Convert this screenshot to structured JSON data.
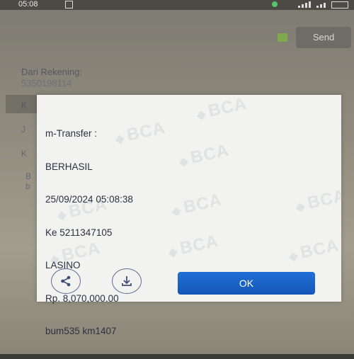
{
  "status_bar": {
    "time": "05:08"
  },
  "background": {
    "send_label": "Send",
    "from_account_label": "Dari Rekening:",
    "from_account_value": "5350198114",
    "fragments": [
      "K",
      "J",
      "K",
      "B",
      "b"
    ]
  },
  "dialog": {
    "receipt_lines": [
      "m-Transfer :",
      "BERHASIL",
      "25/09/2024 05:08:38",
      "Ke 5211347105",
      "LASINO",
      "Rp. 8,070,000.00",
      "bum535 km1407"
    ],
    "watermark": "BCA",
    "share_icon": "share-icon",
    "download_icon": "download-icon",
    "ok_label": "OK"
  },
  "colors": {
    "ok_button": "#1a63c8",
    "dialog_bg": "#f2f2f0",
    "icon_outline": "#5b6b92"
  }
}
